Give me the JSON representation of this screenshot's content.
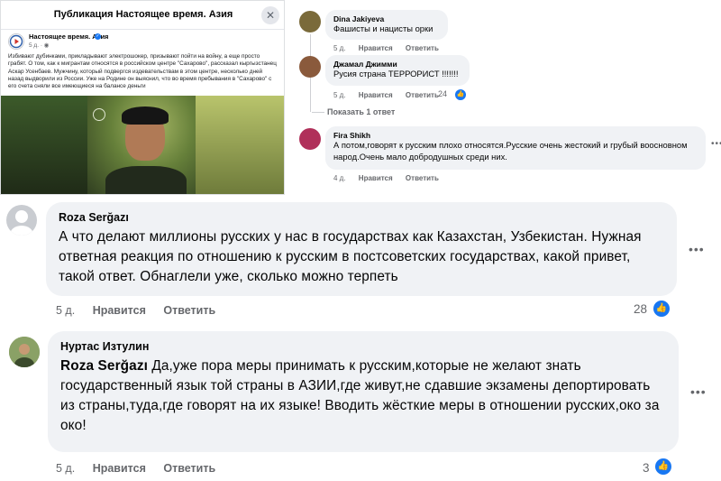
{
  "post": {
    "title": "Публикация Настоящее время. Азия",
    "close_glyph": "✕",
    "page_name": "Настоящее время. Азия",
    "time": "5 д. · ",
    "text": "Избивают дубинками, прикладывают электрошокер, призывают пойти на войну, а еще просто грабят. О том, как к мигрантам относятся в российском центре \"Сахарово\", рассказал кыргызстанец Аскар Усенбаев. Мужчину, который подвергся издевательствам в этом центре, несколько дней назад выдворили из России. Уже на Родине он выяснил, что во время пребывания в \"Сахарово\" с его счета сняли все имеющиеся на балансе деньги"
  },
  "comments_top": [
    {
      "author": "Dina Jakiyeva",
      "text": "Фашисты и нацисты орки",
      "time": "5 д.",
      "like_label": "Нравится",
      "reply_label": "Ответить",
      "avatar_color": "#7a6a3a"
    },
    {
      "author": "Джамал Джимми",
      "text": "Русия страна ТЕРРОРИСТ !!!!!!!",
      "time": "5 д.",
      "like_label": "Нравится",
      "reply_label": "Ответить",
      "reactions": "24",
      "avatar_color": "#8a5a3c"
    },
    {
      "author": "Fira Shikh",
      "text": "А потом,говорят к русским плохо относятся.Русские очень жестокий и грубый вооснoвном народ.Очень мало добродушных среди них.",
      "time": "4 д.",
      "like_label": "Нравится",
      "reply_label": "Ответить",
      "avatar_color": "#b0305a"
    }
  ],
  "show_replies_label": "Показать 1 ответ",
  "comments_main": [
    {
      "author": "Roza Serğazı",
      "text": "А что делают миллионы русских у нас в государствах как Казахстан, Узбекистан. Нужная ответная реакция по отношению к русским в постсоветских государствах, какой привет, такой ответ. Обнаглели уже, сколько можно терпеть",
      "time": "5 д.",
      "like_label": "Нравится",
      "reply_label": "Ответить",
      "reactions": "28",
      "avatar_color": "#c9ccd1"
    },
    {
      "author": "Нуртас Изтулин",
      "mention": "Roza Serğazı",
      "text": " Да,уже пора меры принимать к русским,которые не желают знать государственный язык той страны в АЗИИ,где живут,не сдавшие экзамены депортировать из страны,туда,где говорят на их языке! Вводить жёсткие меры в отношении русских,око за око!",
      "time": "5 д.",
      "like_label": "Нравится",
      "reply_label": "Ответить",
      "reactions": "3",
      "avatar_color": "#6e8a4e"
    }
  ],
  "icons": {
    "like": "thumbs-up-icon",
    "more": "more-options-icon",
    "verified": "verified-badge-icon",
    "close": "close-icon"
  },
  "colors": {
    "like_blue": "#1877f2",
    "bubble_bg": "#f0f2f5",
    "meta_gray": "#65676b"
  }
}
